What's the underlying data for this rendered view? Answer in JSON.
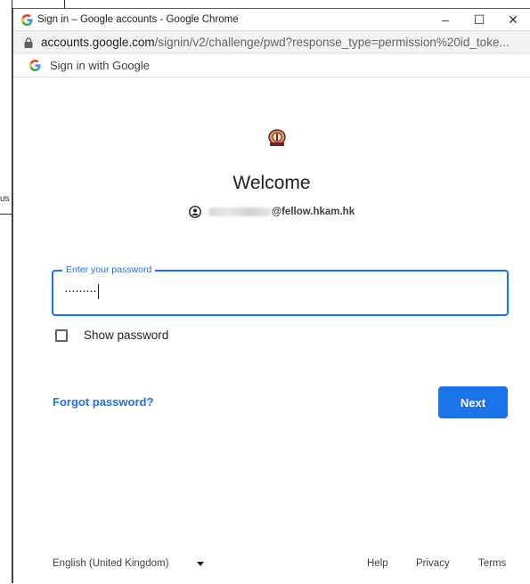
{
  "background": {
    "fragment_text": "us"
  },
  "window": {
    "title": "Sign in – Google accounts - Google Chrome",
    "controls": {
      "minimize": "–",
      "maximize": "☐",
      "close": "✕"
    }
  },
  "addressbar": {
    "host": "accounts.google.com",
    "path": "/signin/v2/challenge/pwd?response_type=permission%20id_toke..."
  },
  "google_bar": {
    "label": "Sign in with Google"
  },
  "main": {
    "heading": "Welcome",
    "account_email_suffix": "@fellow.hkam.hk",
    "password_label": "Enter your password",
    "password_value": "·········",
    "show_password_label": "Show password",
    "forgot_label": "Forgot password?",
    "next_label": "Next"
  },
  "footer": {
    "language": "English (United Kingdom)",
    "help": "Help",
    "privacy": "Privacy",
    "terms": "Terms"
  },
  "colors": {
    "accent": "#1a73e8",
    "text": "#202124",
    "muted": "#5f6368"
  }
}
